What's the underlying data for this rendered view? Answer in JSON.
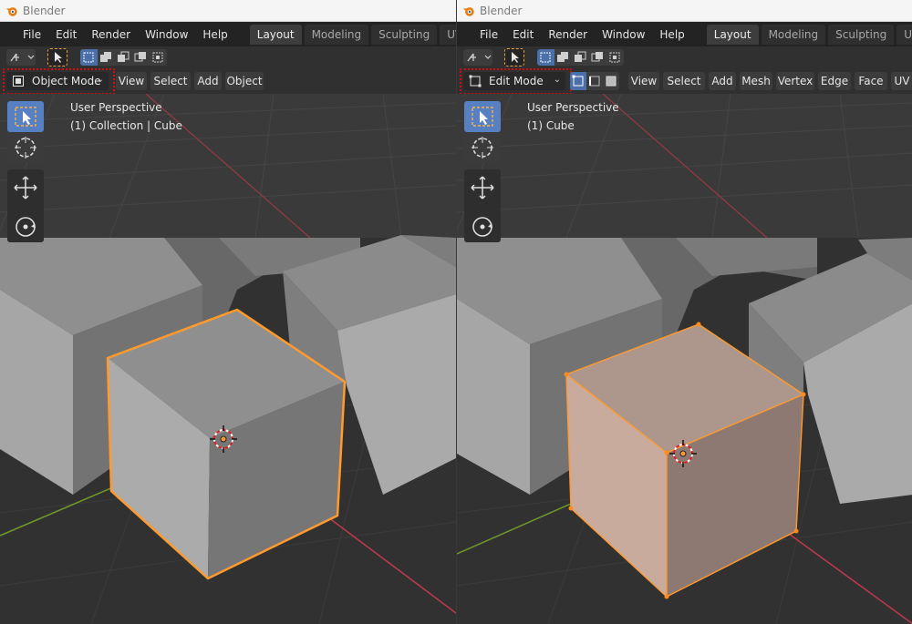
{
  "app": {
    "title": "Blender"
  },
  "menus": [
    "File",
    "Edit",
    "Render",
    "Window",
    "Help"
  ],
  "workspaces": [
    "Layout",
    "Modeling",
    "Sculpting",
    "UV Editing"
  ],
  "left": {
    "mode_label": "Object Mode",
    "header_buttons": [
      "View",
      "Select",
      "Add",
      "Object"
    ],
    "viewport_title": "User Perspective",
    "viewport_subtitle": "(1) Collection | Cube"
  },
  "right": {
    "mode_label": "Edit Mode",
    "header_buttons": [
      "View",
      "Select",
      "Add",
      "Mesh",
      "Vertex",
      "Edge",
      "Face",
      "UV"
    ],
    "viewport_title": "User Perspective",
    "viewport_subtitle": "(1) Cube"
  },
  "colors": {
    "selection_outline": "#ff9a2e",
    "edit_face_tint": "#c8a08c",
    "highlight_box": "#d40c0c",
    "active_tool": "#5680c2",
    "x_axis": "#c0394b",
    "y_axis": "#6f9a2a"
  }
}
